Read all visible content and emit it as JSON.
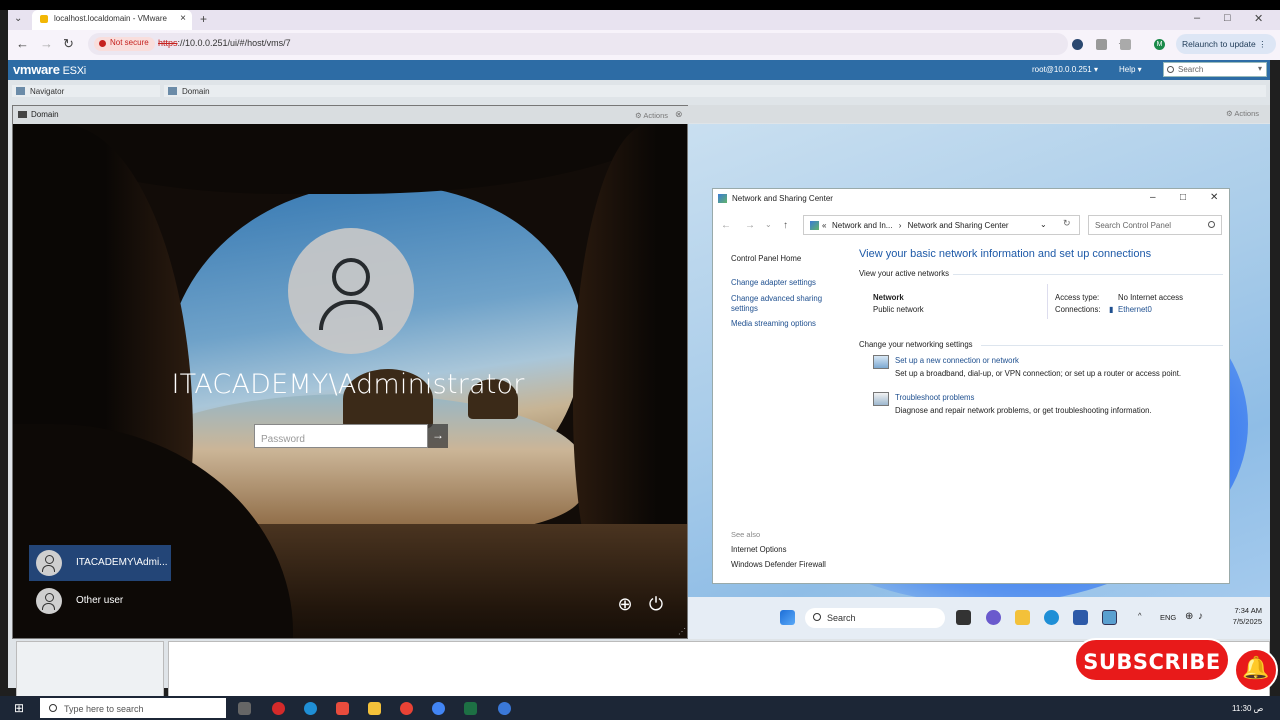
{
  "browser": {
    "tab_title": "localhost.localdomain - VMware",
    "not_secure": "Not secure",
    "url_scheme": "https",
    "url_rest": "://10.0.0.251/ui/#/host/vms/7",
    "relaunch": "Relaunch to update",
    "profile_initial": "M"
  },
  "esxi": {
    "logo": "vmware",
    "product": "ESXi",
    "user": "root@10.0.0.251 ▾",
    "help": "Help ▾",
    "search_placeholder": "Search",
    "navigator": "Navigator",
    "domain_tab": "Domain"
  },
  "console": {
    "title": "Domain",
    "actions": "Actions",
    "username": "ITACADEMY\\Administrator",
    "password_placeholder": "Password",
    "users": [
      {
        "label": "ITACADEMY\\Admi..."
      },
      {
        "label": "Other user"
      }
    ]
  },
  "right_vm": {
    "actions": "Actions"
  },
  "nsc": {
    "title": "Network and Sharing Center",
    "crumb_1": "Network and In...",
    "crumb_sep": "›",
    "crumb_2": "Network and Sharing Center",
    "search_placeholder": "Search Control Panel",
    "left_links": [
      "Control Panel Home",
      "Change adapter settings",
      "Change advanced sharing settings",
      "Media streaming options"
    ],
    "see_also": "See also",
    "see_also_links": [
      "Internet Options",
      "Windows Defender Firewall"
    ],
    "heading": "View your basic network information and set up connections",
    "active_networks": "View your active networks",
    "network_name": "Network",
    "network_type": "Public network",
    "access_type_label": "Access type:",
    "access_type_value": "No Internet access",
    "connections_label": "Connections:",
    "connections_value": "Ethernet0",
    "change_settings": "Change your networking settings",
    "setup_link": "Set up a new connection or network",
    "setup_desc": "Set up a broadband, dial-up, or VPN connection; or set up a router or access point.",
    "trouble_link": "Troubleshoot problems",
    "trouble_desc": "Diagnose and repair network problems, or get troubleshooting information."
  },
  "guest_taskbar": {
    "search": "Search",
    "lang": "ENG",
    "time": "7:34 AM",
    "date": "7/5/2025"
  },
  "host_taskbar": {
    "search": "Type here to search",
    "time": "11:30 ص"
  },
  "overlay": {
    "subscribe": "SUBSCRIBE"
  }
}
